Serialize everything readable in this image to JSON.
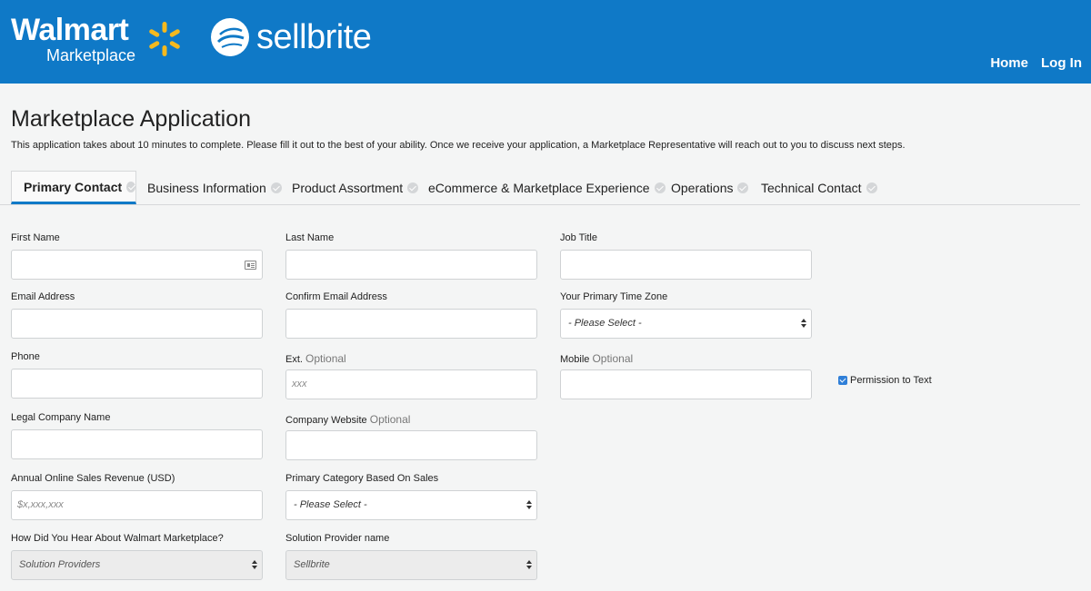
{
  "header": {
    "walmart_word": "Walmart",
    "walmart_sub": "Marketplace",
    "sellbrite_word": "sellbrite",
    "nav": [
      {
        "label": "Home"
      },
      {
        "label": "Log In"
      }
    ],
    "background_color": "#0f79c7",
    "spark_color": "#f5b91e"
  },
  "page": {
    "title": "Marketplace Application",
    "intro": "This application takes about 10 minutes to complete. Please fill it out to the best of your ability. Once we receive your application, a Marketplace Representative will reach out to you to discuss next steps."
  },
  "tabs": [
    {
      "label": "Primary Contact",
      "active": true
    },
    {
      "label": "Business Information"
    },
    {
      "label": "Product Assortment"
    },
    {
      "label": "eCommerce & Marketplace Experience"
    },
    {
      "label": "Operations"
    },
    {
      "label": "Technical Contact"
    }
  ],
  "form": {
    "first_name": {
      "label": "First Name",
      "value": ""
    },
    "last_name": {
      "label": "Last Name",
      "value": ""
    },
    "job_title": {
      "label": "Job Title",
      "value": ""
    },
    "email": {
      "label": "Email Address",
      "value": ""
    },
    "confirm_email": {
      "label": "Confirm Email Address",
      "value": ""
    },
    "time_zone": {
      "label": "Your Primary Time Zone",
      "selected": "- Please Select -"
    },
    "phone": {
      "label": "Phone",
      "value": ""
    },
    "ext": {
      "label": "Ext.",
      "optional": "Optional",
      "placeholder": "xxx"
    },
    "mobile": {
      "label": "Mobile",
      "optional": "Optional",
      "value": ""
    },
    "permission_to_text": {
      "label": "Permission to Text",
      "checked": true
    },
    "legal_company": {
      "label": "Legal Company Name",
      "value": ""
    },
    "company_website": {
      "label": "Company Website",
      "optional": "Optional",
      "value": ""
    },
    "annual_revenue": {
      "label": "Annual Online Sales Revenue (USD)",
      "placeholder": "$x,xxx,xxx"
    },
    "primary_category": {
      "label": "Primary Category Based On Sales",
      "selected": "- Please Select -"
    },
    "hear_about": {
      "label": "How Did You Hear About Walmart Marketplace?",
      "selected": "Solution Providers"
    },
    "solution_provider": {
      "label": "Solution Provider name",
      "selected": "Sellbrite"
    }
  }
}
